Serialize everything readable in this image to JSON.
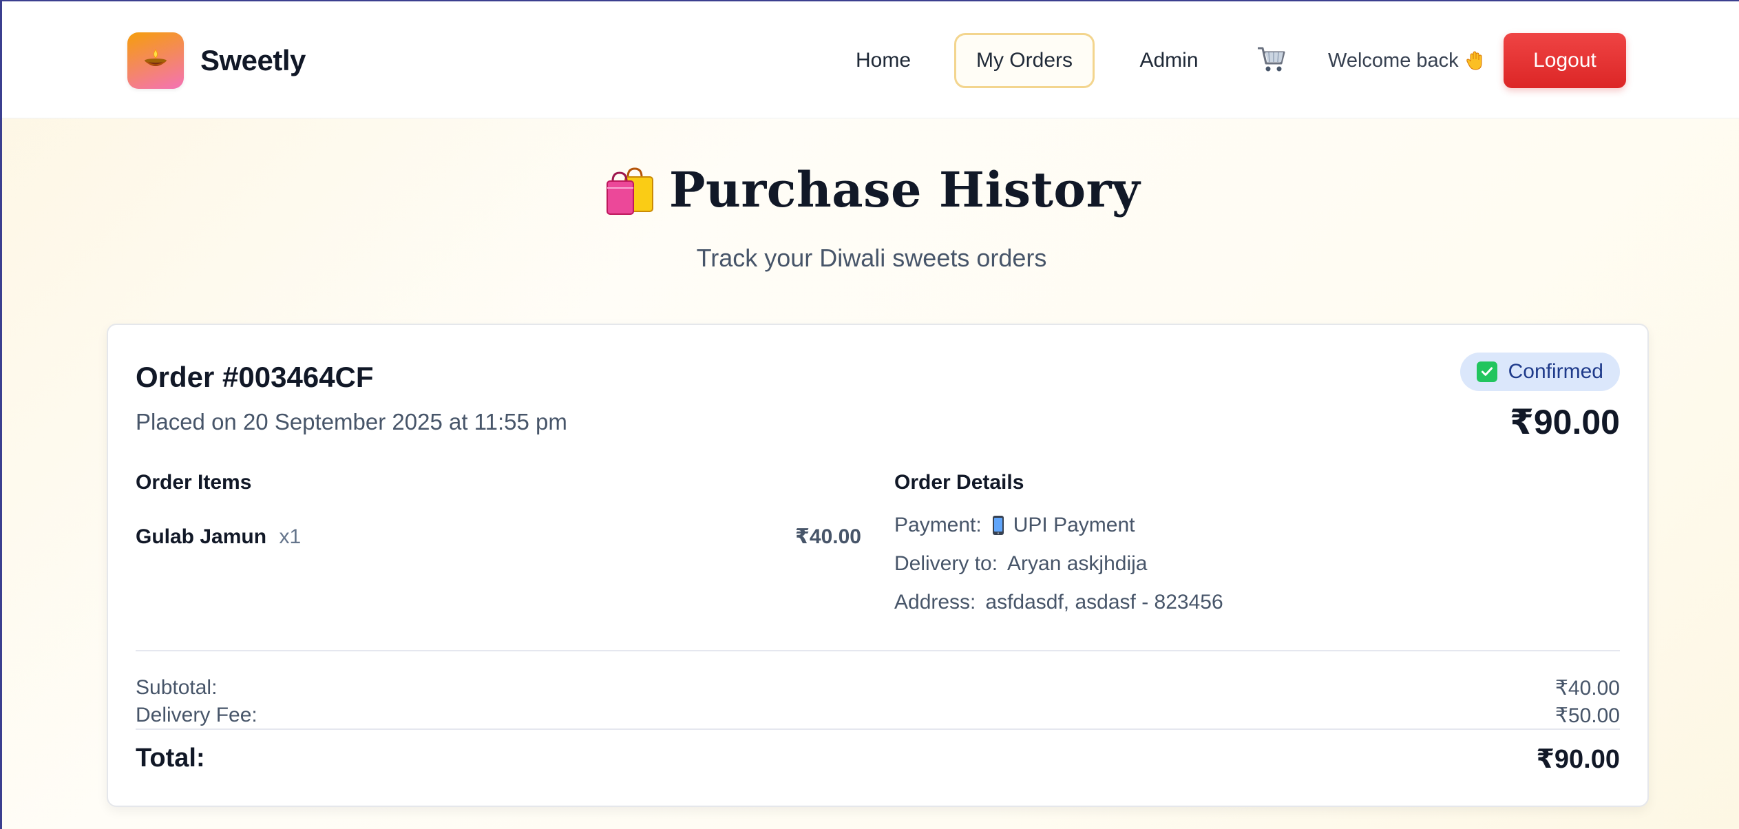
{
  "navbar": {
    "brand": "Sweetly",
    "logo_icon": "diya-lamp-icon",
    "links": [
      {
        "label": "Home"
      },
      {
        "label": "My Orders"
      },
      {
        "label": "Admin"
      }
    ],
    "cart_icon": "shopping-cart-icon",
    "welcome": "Welcome back",
    "wave_icon": "waving-hand-icon",
    "logout_label": "Logout"
  },
  "header": {
    "title": "Purchase History",
    "title_icon": "shopping-bags-icon",
    "subtitle": "Track your Diwali sweets orders"
  },
  "order": {
    "id": "Order #003464CF",
    "placed": "Placed on 20 September 2025 at 11:55 pm",
    "status": "Confirmed",
    "status_icon": "check-mark-icon",
    "total_top": "₹90.00",
    "items_title": "Order Items",
    "items": [
      {
        "name": "Gulab Jamun",
        "qty": "x1",
        "price": "₹40.00"
      }
    ],
    "details_title": "Order Details",
    "details": {
      "payment_label": "Payment:",
      "payment_icon": "mobile-phone-icon",
      "payment_value": "UPI Payment",
      "delivery_label": "Delivery to:",
      "delivery_value": "Aryan askjhdija",
      "address_label": "Address:",
      "address_value": "asfdasdf, asdasf - 823456"
    },
    "summary": {
      "subtotal_label": "Subtotal:",
      "subtotal_value": "₹40.00",
      "delivery_fee_label": "Delivery Fee:",
      "delivery_fee_value": "₹50.00",
      "total_label": "Total:",
      "total_value": "₹90.00"
    }
  },
  "colors": {
    "accent_red": "#dc2626",
    "active_border": "#f3d58e",
    "status_bg": "#dbe7fb",
    "status_text": "#1e3a8a"
  }
}
